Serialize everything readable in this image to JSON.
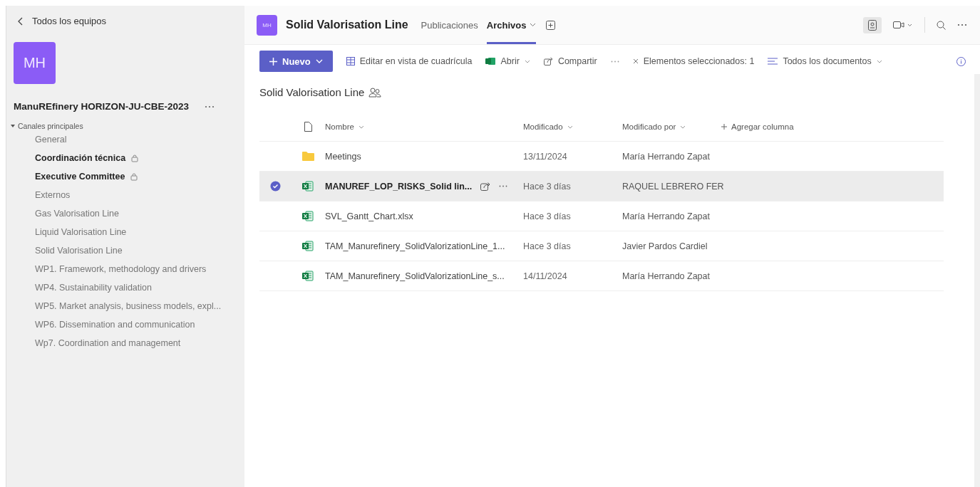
{
  "sidebar": {
    "back_link": "Todos los equipos",
    "team_avatar": "MH",
    "team_name": "ManuREfinery HORIZON-JU-CBE-2023",
    "section": {
      "label": "Canales principales",
      "expanded": true
    },
    "channels": [
      {
        "name": "General",
        "unread": false,
        "private": false
      },
      {
        "name": "Coordinación técnica",
        "unread": true,
        "private": true
      },
      {
        "name": "Executive Committee",
        "unread": true,
        "private": true
      },
      {
        "name": "Externos",
        "unread": false,
        "private": false
      },
      {
        "name": "Gas Valorisation Line",
        "unread": false,
        "private": false
      },
      {
        "name": "Liquid Valorisation Line",
        "unread": false,
        "private": false
      },
      {
        "name": "Solid Valorisation Line",
        "unread": false,
        "private": false
      },
      {
        "name": "WP1. Framework, methodology and drivers",
        "unread": false,
        "private": false
      },
      {
        "name": "WP4. Sustainability validation",
        "unread": false,
        "private": false
      },
      {
        "name": "WP5. Market analysis, business models, expl...",
        "unread": false,
        "private": false
      },
      {
        "name": "WP6. Dissemination and communication",
        "unread": false,
        "private": false
      },
      {
        "name": "Wp7. Coordination and management",
        "unread": false,
        "private": false
      }
    ]
  },
  "header": {
    "avatar": "MH",
    "title": "Solid Valorisation Line",
    "tabs": [
      {
        "label": "Publicaciones",
        "selected": false
      },
      {
        "label": "Archivos",
        "selected": true
      }
    ]
  },
  "toolbar": {
    "new_button": "Nuevo",
    "grid_edit": "Editar en vista de cuadrícula",
    "open": "Abrir",
    "share": "Compartir",
    "selection": "Elementos seleccionados: 1",
    "view": "Todos los documentos"
  },
  "library": {
    "title": "Solid Valorisation Line",
    "columns": [
      "Nombre",
      "Modificado",
      "Modificado por"
    ],
    "add_column": "Agregar columna",
    "rows": [
      {
        "kind": "folder",
        "name": "Meetings",
        "modified": "13/11/2024",
        "modified_by": "María Herrando Zapat",
        "selected": false
      },
      {
        "kind": "excel",
        "name": "MANUREF_LOP_RISKS_Solid lin...",
        "modified": "Hace 3 días",
        "modified_by": "RAQUEL LEBRERO FER",
        "selected": true
      },
      {
        "kind": "excel",
        "name": "SVL_Gantt_Chart.xlsx",
        "modified": "Hace 3 días",
        "modified_by": "María Herrando Zapat",
        "selected": false
      },
      {
        "kind": "excel",
        "name": "TAM_Manurefinery_SolidValorizationLine_1...",
        "modified": "Hace 3 días",
        "modified_by": "Javier Pardos Cardiel",
        "selected": false
      },
      {
        "kind": "excel",
        "name": "TAM_Manurefinery_SolidValorizationLine_s...",
        "modified": "14/11/2024",
        "modified_by": "María Herrando Zapat",
        "selected": false
      }
    ]
  }
}
